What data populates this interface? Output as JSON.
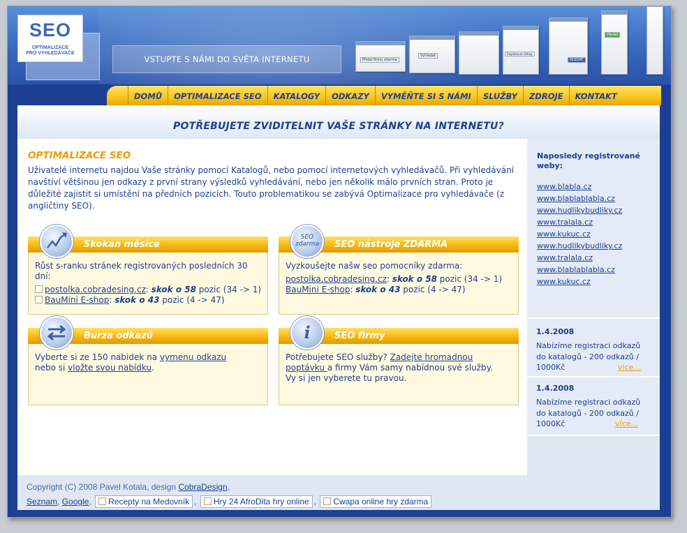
{
  "logo": {
    "title": "SEO",
    "subtitle_1": "OPTIMALIZACE",
    "subtitle_2": "PRO VYHLEDÁVAČE"
  },
  "slogan": "VSTUPTE S NÁMI DO SVĚTA INTERNETU",
  "header_shots": {
    "s1": "Přidat firmu zdarma",
    "s2": "Vyhledat",
    "s3": "Registrovat eShop",
    "s4": "HLEDAT",
    "s5": "Hledat"
  },
  "nav": {
    "items": [
      "DOMŮ",
      "OPTIMALIZACE SEO",
      "KATALOGY",
      "ODKAZY",
      "VYMĚŇTE SI S NÁMI",
      "SLUŽBY",
      "ZDROJE",
      "KONTAKT"
    ]
  },
  "tagline": "POTŘEBUJETE ZVIDITELNIT VAŠE STRÁNKY NA INTERNETU?",
  "main": {
    "title": "OPTIMALIZACE SEO",
    "intro": "Uživatelé internetu najdou Vaše stránky pomocí Katalogů, nebo pomocí internetových vyhledávačů. Při vyhledávání navštíví většinou jen odkazy z první strany výsledků vyhledávání, nebo jen několik málo prvních stran. Proto je důležité zajistit si umístění na předních pozicích. Touto problematikou se zabývá Optimalizace pro vyhledávače (z angličtiny SEO)."
  },
  "box_skokan": {
    "title": "Skokan měsíce",
    "text": "Růst s-ranku stránek registrovaných posledních 30 dní:",
    "items": [
      {
        "link": "postolka.cobradesing.cz",
        "sep": ": ",
        "em": "skok o 58",
        "rest": " pozic (34 -> 1)"
      },
      {
        "link": "BauMini E-shop",
        "sep": ": ",
        "em": "skok o 43",
        "rest": " pozic (4 -> 47)"
      }
    ]
  },
  "box_nastroje": {
    "title": "SEO nástroje ZDARMA",
    "icon_text_1": "SEO",
    "icon_text_2": "zdarma",
    "text": "Vyzkoušejte našw seo pomocníky zdarma:",
    "items": [
      {
        "link": "postolka.cobradesing.cz",
        "sep": ": ",
        "em": "skok o 58",
        "rest": " pozic (34 -> 1)"
      },
      {
        "link": "BauMini E-shop",
        "sep": ": ",
        "em": "skok o 43",
        "rest": " pozic (4 -> 47)"
      }
    ]
  },
  "box_burza": {
    "title": "Burza odkazů",
    "t1": "Vyberte si ze 150 nabidek na ",
    "l1": "vymenu odkazu",
    "t2": "nebo si ",
    "l2": "vložte svou nabídku",
    "t3": "."
  },
  "box_firmy": {
    "title": "SEO firmy",
    "t1": "Potřebujete SEO služby? ",
    "l1": "Zadejte hromadnou poptávku ",
    "t2": "a firmy Vám samy nabídnou své služby.",
    "t3": "Vy si jen vyberete tu pravou."
  },
  "sidebar": {
    "heading": "Naposledy registrované weby:",
    "links": [
      "www.blabla.cz",
      "www.blablablabla.cz",
      "www.hudlikybudliky.cz",
      "www.tralala.cz",
      "www.kukuc.cz",
      "www.hudlikybudliky.cz",
      "www.tralala.cz",
      "www.blablablabla.cz",
      "www.kukuc.cz"
    ],
    "news": [
      {
        "date": "1.4.2008",
        "text": "Nabízíme registraci odkazů do katalogů - 200 odkazů / 1000Kč",
        "more": "více..."
      },
      {
        "date": "1.4.2008",
        "text": "Nabízíme registraci odkazů do katalogů - 200 odkazů / 1000Kč",
        "more": "více..."
      }
    ]
  },
  "footer": {
    "copyright": "Copyright (C) 2008 Pavel Kotala, design ",
    "design_link": "CobraDesign",
    "comma": ",",
    "l1": "Seznam",
    "l2": "Google",
    "b1": "Recepty na Medovník",
    "b2": "Hry 24 AfroDita hry online",
    "b3": "Cwapa online hry zdarma"
  },
  "colors": {
    "brand_blue": "#1d3f93",
    "accent_orange": "#f09a00",
    "nav_yellow": "#fbc51a"
  }
}
